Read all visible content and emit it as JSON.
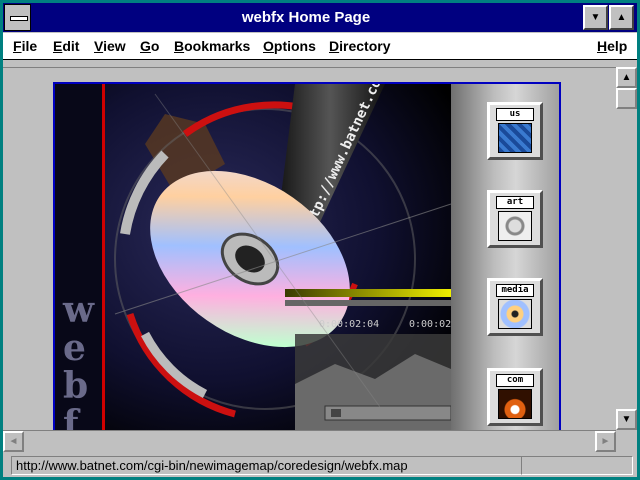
{
  "window": {
    "title": "webfx Home Page",
    "minimize_glyph": "▼",
    "maximize_glyph": "▲"
  },
  "menubar": {
    "items": [
      "File",
      "Edit",
      "View",
      "Go",
      "Bookmarks",
      "Options",
      "Directory",
      "Help"
    ]
  },
  "imagemap": {
    "timecode_a": "0:00:02:04",
    "timecode_b": "0:00:02",
    "url_stream_text": "http://www.batnet.com",
    "side_letters": [
      "w",
      "e",
      "b",
      "f"
    ],
    "nav_buttons": [
      {
        "label": "us",
        "icon": "globe-icon"
      },
      {
        "label": "art",
        "icon": "sun-face-icon"
      },
      {
        "label": "media",
        "icon": "cd-icon"
      },
      {
        "label": "com",
        "icon": "people-icon"
      }
    ]
  },
  "scrollbars": {
    "up_glyph": "▲",
    "down_glyph": "▼",
    "left_glyph": "◄",
    "right_glyph": "►"
  },
  "statusbar": {
    "url": "http://www.batnet.com/cgi-bin/newimagemap/coredesign/webfx.map"
  },
  "colors": {
    "titlebar": "#000080",
    "window_face": "#c0c0c0",
    "desktop": "#008080",
    "imagemap_border": "#0000c0"
  }
}
